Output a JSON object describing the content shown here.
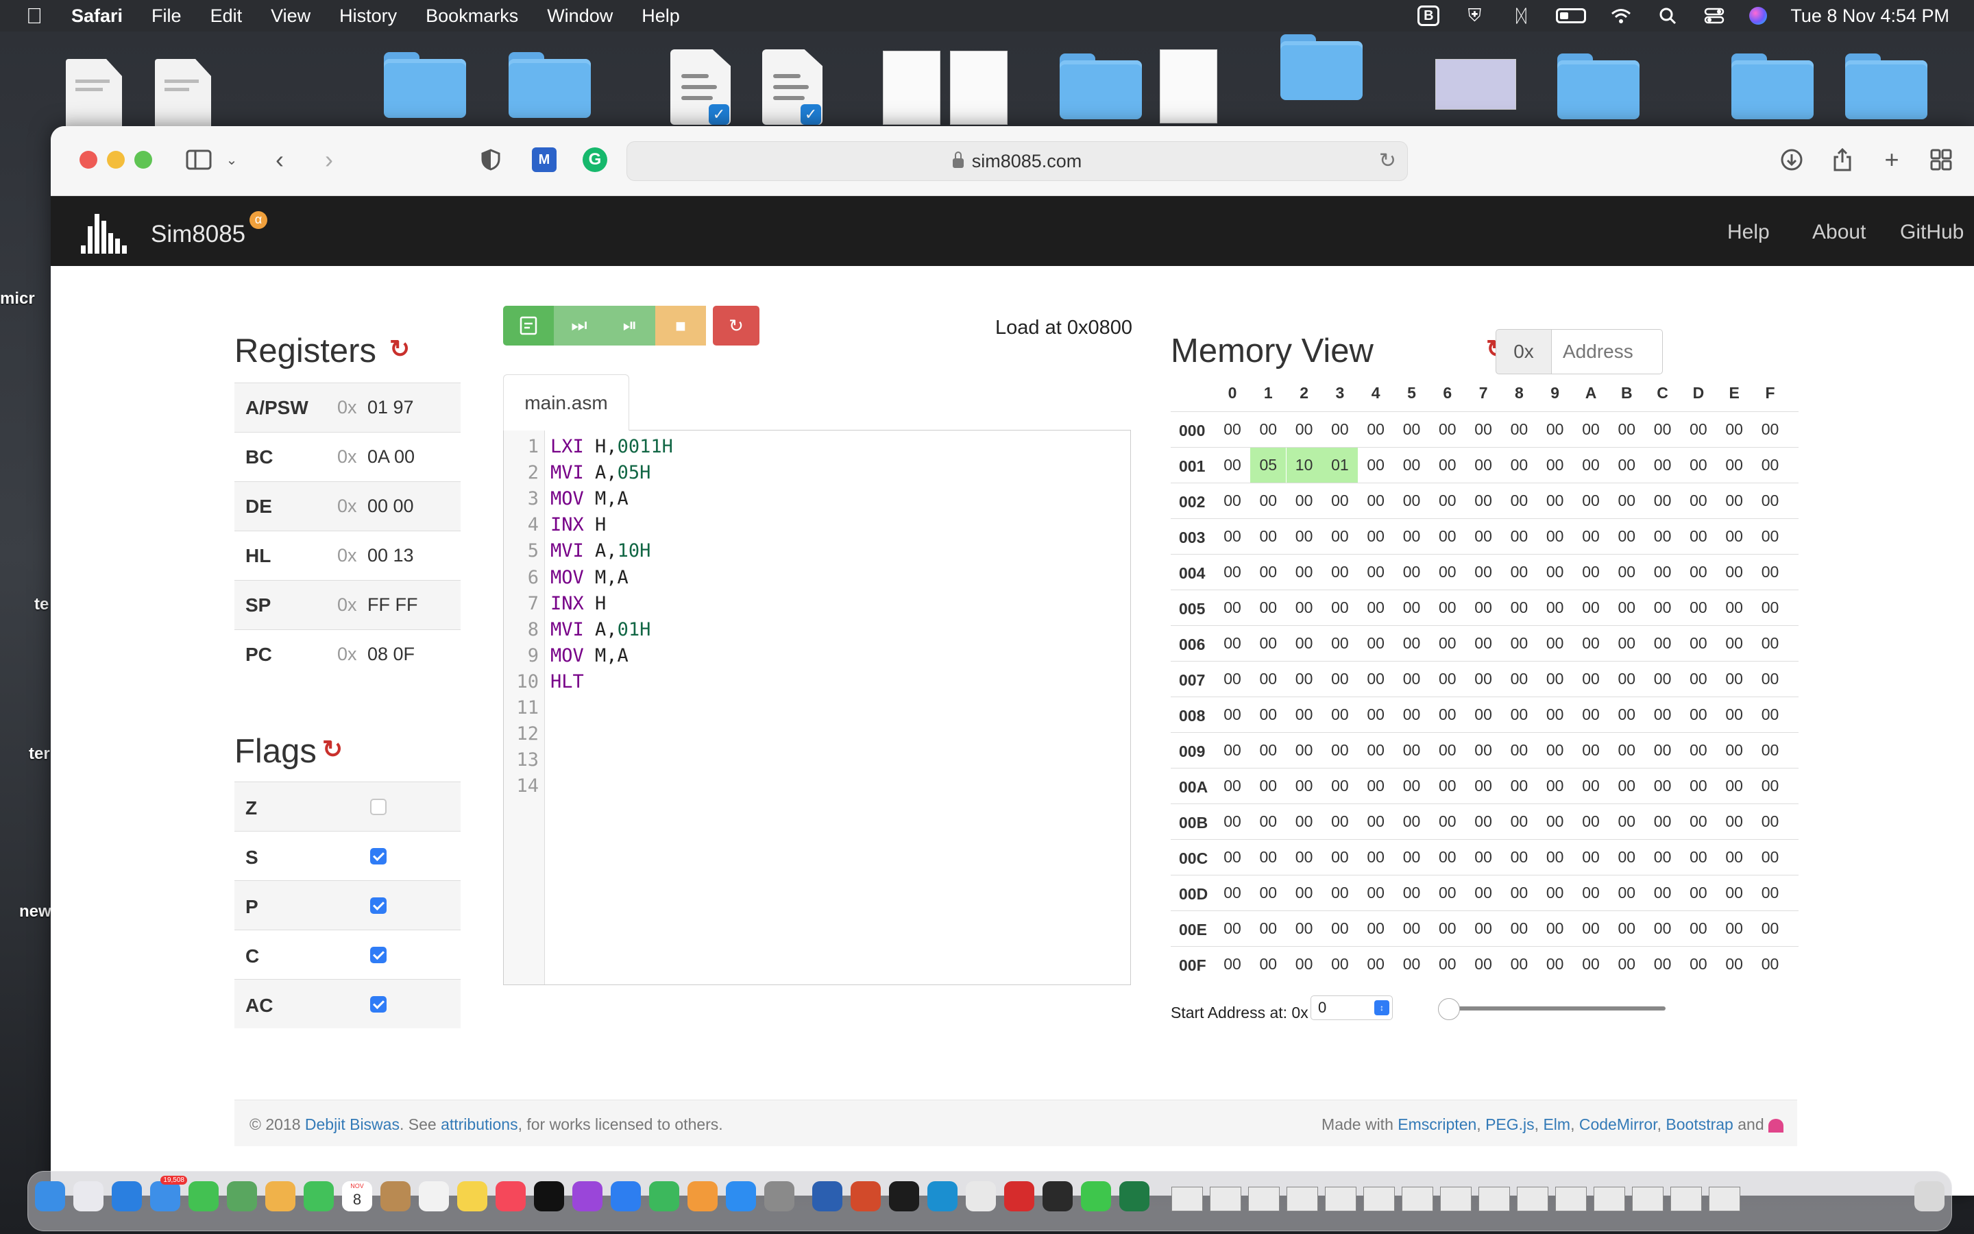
{
  "menubar": {
    "app_name": "Safari",
    "items": [
      "File",
      "Edit",
      "View",
      "History",
      "Bookmarks",
      "Window",
      "Help"
    ],
    "datetime": "Tue 8 Nov  4:54 PM",
    "icons": [
      "bbedit-icon",
      "vpn-shield-icon",
      "bluetooth-icon",
      "battery-icon",
      "wifi-icon",
      "spotlight-search-icon",
      "control-center-icon",
      "siri-icon"
    ]
  },
  "desktop": {
    "side_labels": [
      "micr",
      "te",
      "ter",
      "new"
    ],
    "icons": [
      "document-icon",
      "document-icon",
      "folder-icon",
      "folder-icon",
      "vscode-document-icon",
      "vscode-document-icon",
      "document-thumbnail",
      "folder-icon",
      "document-thumbnail",
      "folder-icon",
      "screenshot-thumbnail",
      "folder-icon",
      "folder-icon",
      "folder-icon"
    ]
  },
  "browser": {
    "url": "sim8085.com",
    "toolbar_icons": [
      "sidebar-icon",
      "chevron-down-icon",
      "back-icon",
      "forward-icon",
      "privacy-shield-icon",
      "extension-icon",
      "grammarly-icon",
      "reload-icon",
      "download-icon",
      "share-icon",
      "new-tab-icon",
      "tab-overview-icon"
    ]
  },
  "navbar": {
    "brand": "Sim8085",
    "badge": "α",
    "links": {
      "help": "Help",
      "about": "About",
      "github": "GitHub"
    }
  },
  "registers": {
    "title": "Registers",
    "prefix": "0x",
    "rows": [
      {
        "name": "A/PSW",
        "value": "01 97"
      },
      {
        "name": "BC",
        "value": "0A 00"
      },
      {
        "name": "DE",
        "value": "00 00"
      },
      {
        "name": "HL",
        "value": "00 13"
      },
      {
        "name": "SP",
        "value": "FF FF"
      },
      {
        "name": "PC",
        "value": "08 0F"
      }
    ]
  },
  "flags": {
    "title": "Flags",
    "rows": [
      {
        "name": "Z",
        "checked": false
      },
      {
        "name": "S",
        "checked": true
      },
      {
        "name": "P",
        "checked": true
      },
      {
        "name": "C",
        "checked": true
      },
      {
        "name": "AC",
        "checked": true
      }
    ]
  },
  "controls": {
    "buttons": [
      "assemble-button",
      "run-button",
      "step-button",
      "stop-button",
      "reset-button"
    ],
    "colors": {
      "green": "#5cb85c",
      "green_light": "#86c886",
      "orange_light": "#f0c27a",
      "red": "#d9534f"
    },
    "load_at": "Load at 0x0800"
  },
  "editor": {
    "file": "main.asm",
    "lines": [
      [
        {
          "t": "LXI",
          "c": "kw"
        },
        {
          "t": " H,",
          "c": "op"
        },
        {
          "t": "0011H",
          "c": "num"
        }
      ],
      [
        {
          "t": "MVI",
          "c": "kw"
        },
        {
          "t": " A,",
          "c": "op"
        },
        {
          "t": "05H",
          "c": "num"
        }
      ],
      [
        {
          "t": "MOV",
          "c": "kw"
        },
        {
          "t": " M,A",
          "c": "op"
        }
      ],
      [
        {
          "t": "INX",
          "c": "kw"
        },
        {
          "t": " H",
          "c": "op"
        }
      ],
      [
        {
          "t": "MVI",
          "c": "kw"
        },
        {
          "t": " A,",
          "c": "op"
        },
        {
          "t": "10H",
          "c": "num"
        }
      ],
      [
        {
          "t": "MOV",
          "c": "kw"
        },
        {
          "t": " M,A",
          "c": "op"
        }
      ],
      [
        {
          "t": "INX",
          "c": "kw"
        },
        {
          "t": " H",
          "c": "op"
        }
      ],
      [
        {
          "t": "MVI",
          "c": "kw"
        },
        {
          "t": " A,",
          "c": "op"
        },
        {
          "t": "01H",
          "c": "num"
        }
      ],
      [
        {
          "t": "MOV",
          "c": "kw"
        },
        {
          "t": " M,A",
          "c": "op"
        }
      ],
      [
        {
          "t": "HLT",
          "c": "kw"
        }
      ],
      [],
      [],
      [],
      []
    ]
  },
  "memory": {
    "title": "Memory View",
    "address_prefix": "0x",
    "address_placeholder": "Address",
    "columns": [
      "0",
      "1",
      "2",
      "3",
      "4",
      "5",
      "6",
      "7",
      "8",
      "9",
      "A",
      "B",
      "C",
      "D",
      "E",
      "F"
    ],
    "rows": [
      "000",
      "001",
      "002",
      "003",
      "004",
      "005",
      "006",
      "007",
      "008",
      "009",
      "00A",
      "00B",
      "00C",
      "00D",
      "00E",
      "00F"
    ],
    "default_value": "00",
    "nonzero": [
      {
        "row": "001",
        "col": "1",
        "value": "05"
      },
      {
        "row": "001",
        "col": "2",
        "value": "10"
      },
      {
        "row": "001",
        "col": "3",
        "value": "01"
      }
    ],
    "start_label": "Start Address at: 0x",
    "start_value": "0",
    "slider_value": 0
  },
  "footer": {
    "copyright": "© 2018 ",
    "author": "Debjit Biswas",
    "see": ". See ",
    "attributions": "attributions",
    "licensed": ", for works licensed to others.",
    "made_with": "Made with ",
    "tools": [
      "Emscripten",
      "PEG.js",
      "Elm",
      "CodeMirror",
      "Bootstrap"
    ],
    "and": " and "
  },
  "dock": {
    "mail_badge": "19,508",
    "calendar_month": "NOV",
    "calendar_day": "8",
    "apps": [
      "finder-icon",
      "launchpad-icon",
      "safari-icon",
      "mail-icon",
      "messages-icon",
      "maps-icon",
      "photos-icon",
      "facetime-icon",
      "calendar-icon",
      "contacts-icon",
      "reminders-icon",
      "notes-icon",
      "music-icon",
      "tv-icon",
      "podcasts-icon",
      "keynote-icon",
      "numbers-icon",
      "pages-icon",
      "app-store-icon",
      "system-preferences-icon",
      "word-icon",
      "powerpoint-icon",
      "terminal-icon",
      "surfshark-icon",
      "vlc-icon",
      "mendeley-icon",
      "figma-icon",
      "whatsapp-icon",
      "excel-icon"
    ]
  }
}
